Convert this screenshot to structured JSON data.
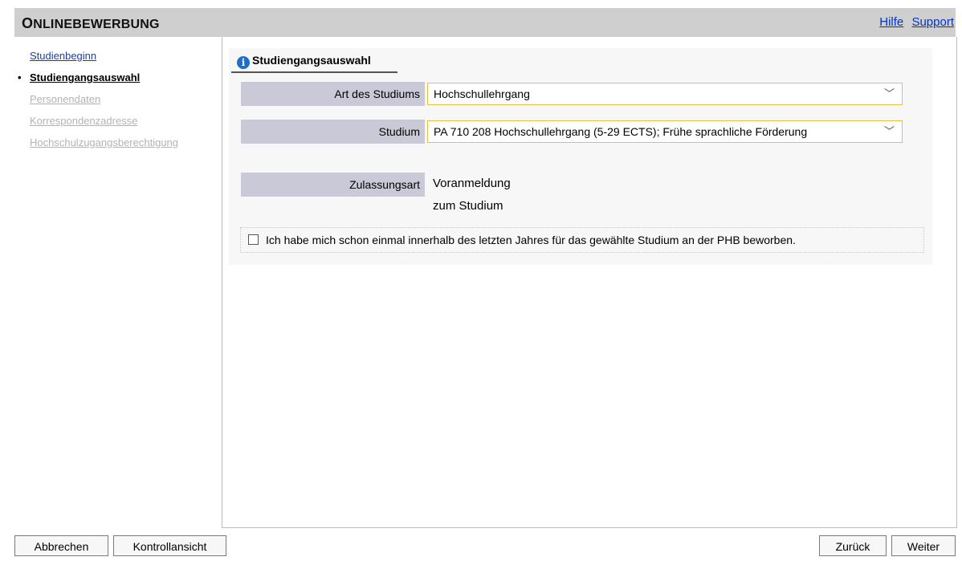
{
  "header": {
    "title_first": "O",
    "title_rest": "NLINEBEWERBUNG",
    "links": [
      "Hilfe",
      "Support"
    ]
  },
  "sidebar": {
    "bullet": "•",
    "items": [
      {
        "label": "Studienbeginn",
        "state": "link"
      },
      {
        "label": "Studiengangsauswahl",
        "state": "current"
      },
      {
        "label": "Personendaten",
        "state": "disabled"
      },
      {
        "label": "Korrespondenzadresse",
        "state": "disabled"
      },
      {
        "label": "Hochschulzugangsberechtigung",
        "state": "disabled"
      }
    ]
  },
  "section": {
    "tab_icon": "info-icon",
    "tab_icon_glyph": "i",
    "tab_label": "Studiengangsauswahl"
  },
  "form": {
    "art_label": "Art des Studiums",
    "art_value": "Hochschullehrgang",
    "studium_label": "Studium",
    "studium_value": "PA 710 208 Hochschullehrgang (5-29 ECTS); Frühe sprachliche Förderung",
    "zulassung_label": "Zulassungsart",
    "zulassung_value": "Voranmeldung zum Studium",
    "checkbox_label": "Ich habe mich schon einmal innerhalb des letzten Jahres für das gewählte Studium an der PHB beworben.",
    "checkbox_checked": false,
    "chevron": "﹀"
  },
  "buttons": {
    "cancel": "Abbrechen",
    "control_view": "Kontrollansicht",
    "back": "Zurück",
    "next": "Weiter"
  },
  "colors": {
    "header_bg": "#cfcfcf",
    "label_bg": "#c9c9d7",
    "select_border": "#e5c342",
    "link": "#1a3ea8",
    "info_icon": "#1f6fc5"
  }
}
